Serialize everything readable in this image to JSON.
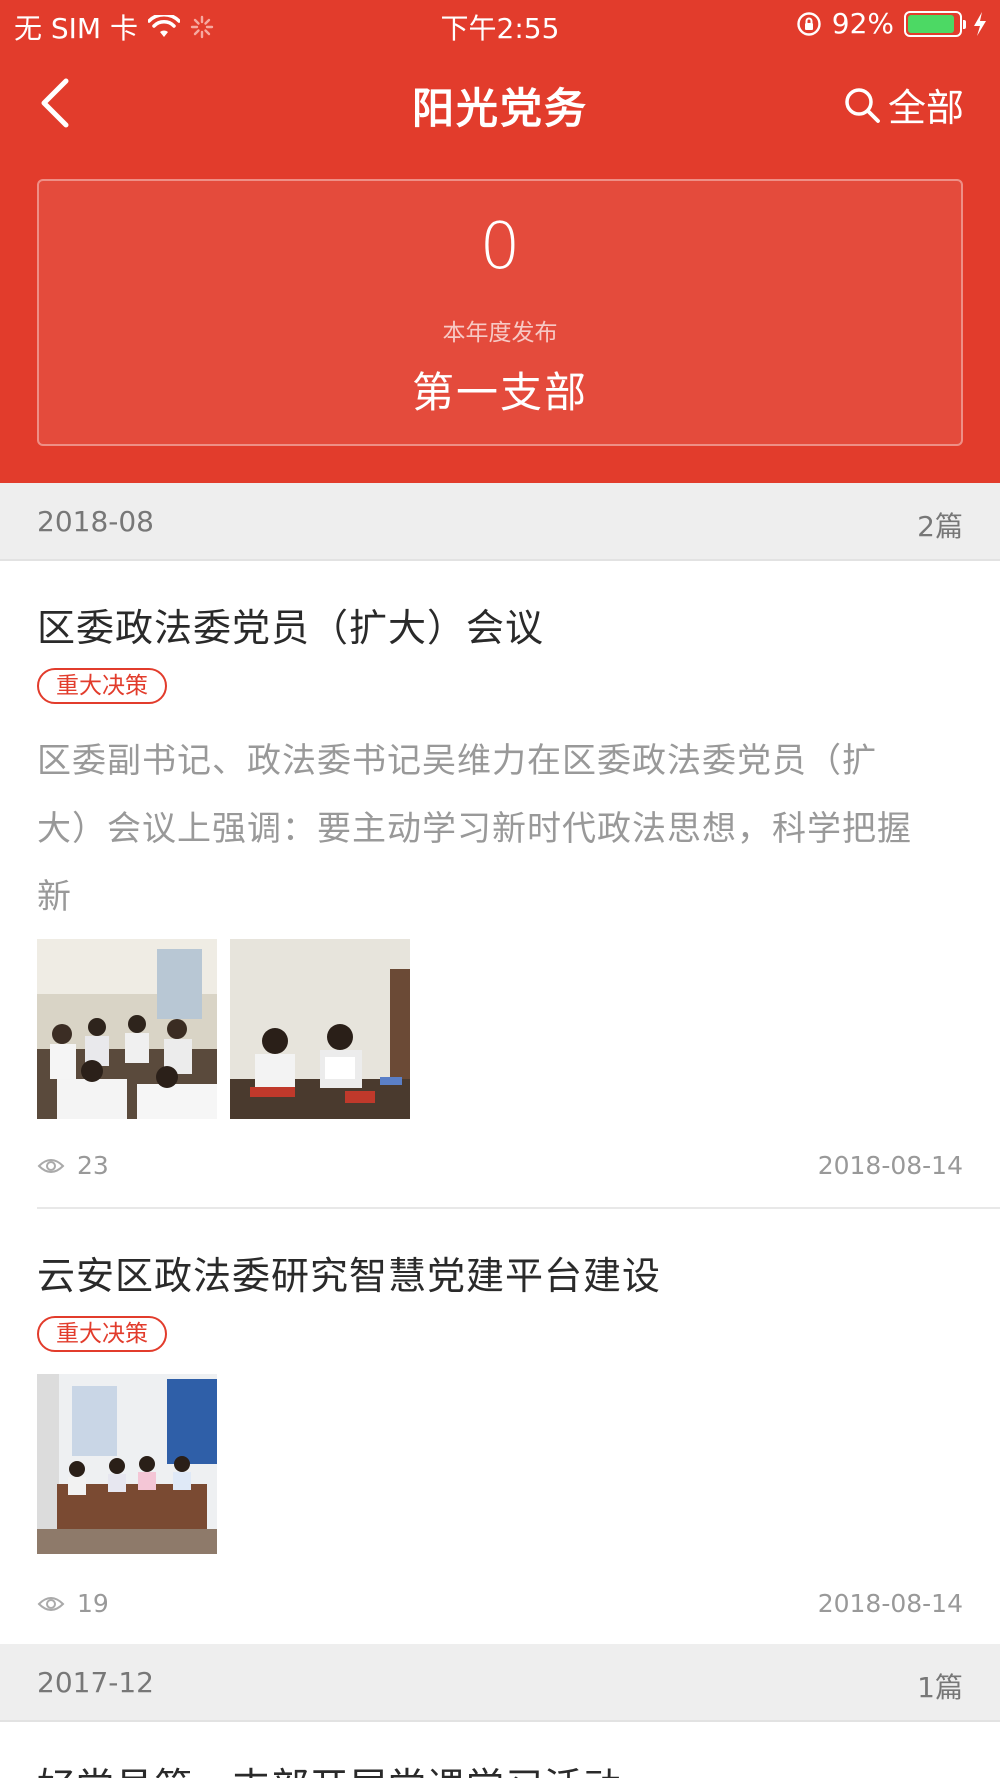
{
  "status_bar": {
    "carrier": "无 SIM 卡",
    "time": "下午2:55",
    "battery_text": "92%",
    "battery_level": 0.92,
    "battery_color": "#4cd964"
  },
  "nav": {
    "title": "阳光党务",
    "back_icon": "chevron-left-icon",
    "search_icon": "search-icon",
    "filter_label": "全部"
  },
  "summary": {
    "count": "0",
    "count_label": "本年度发布",
    "branch": "第一支部"
  },
  "colors": {
    "primary_red": "#e23c2c",
    "group_bg": "#eeeeee",
    "muted_text": "#999999"
  },
  "groups": [
    {
      "month": "2018-08",
      "count": "2篇",
      "articles": [
        {
          "title": "区委政法委党员（扩大）会议",
          "tag": "重大决策",
          "excerpt_lines": [
            "区委副书记、政法委书记吴维力在区委政法委党员（扩",
            "大）会议上强调：要主动学习新时代政法思想，科学把握",
            "新"
          ],
          "views": "23",
          "date": "2018-08-14"
        },
        {
          "title": "云安区政法委研究智慧党建平台建设",
          "tag": "重大决策",
          "views": "19",
          "date": "2018-08-14"
        }
      ]
    },
    {
      "month": "2017-12",
      "count": "1篇",
      "articles": [
        {
          "title": "好党员第一支部开展党课学习活动"
        }
      ]
    }
  ]
}
